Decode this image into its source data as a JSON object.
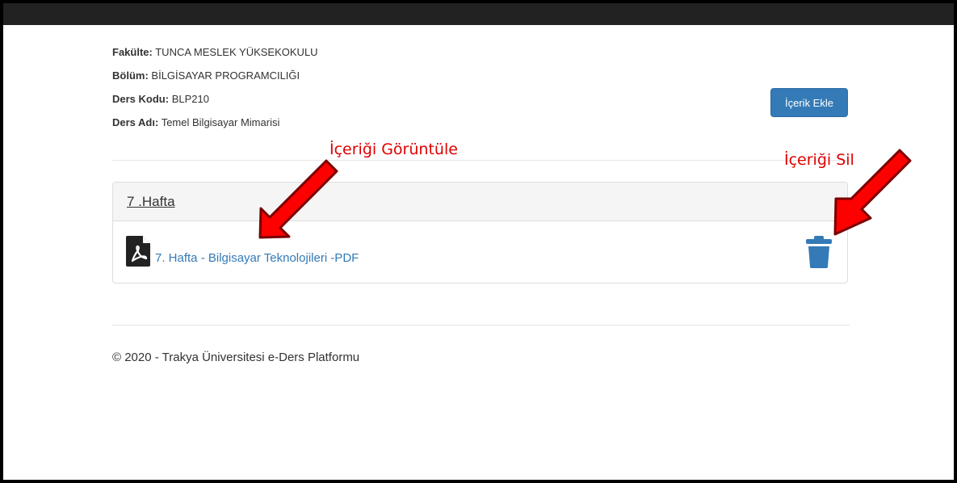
{
  "course_info": {
    "faculty_label": "Fakülte:",
    "faculty_value": "TUNCA MESLEK YÜKSEKOKULU",
    "department_label": "Bölüm:",
    "department_value": "BİLGİSAYAR PROGRAMCILIĞI",
    "course_code_label": "Ders Kodu:",
    "course_code_value": "BLP210",
    "course_name_label": "Ders Adı:",
    "course_name_value": "Temel Bilgisayar Mimarisi"
  },
  "actions": {
    "add_content_label": "İçerik Ekle"
  },
  "week_panel": {
    "title": "7 .Hafta",
    "file_link": "7. Hafta - Bilgisayar Teknolojileri -PDF"
  },
  "annotations": {
    "view_content": "İçeriği Görüntüle",
    "delete_content": "İçeriği Sil"
  },
  "footer": {
    "copyright": "© 2020 - Trakya Üniversitesi e-Ders Platformu"
  },
  "icons": {
    "file": "pdf-file-icon",
    "delete": "trash-icon"
  },
  "colors": {
    "primary": "#337ab7",
    "topbar": "#222222",
    "annotation": "#e00000"
  }
}
